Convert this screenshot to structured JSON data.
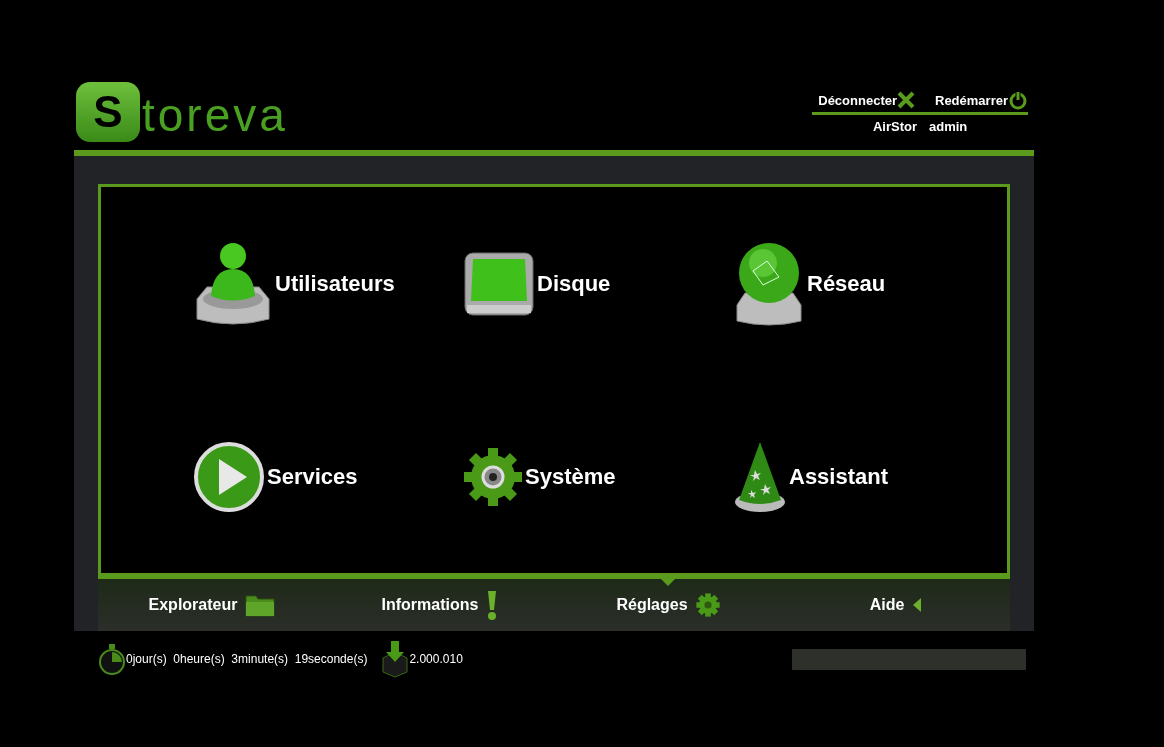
{
  "logo": {
    "letter": "S",
    "rest": "toreva"
  },
  "header_links": [
    {
      "label": "Déconnecter",
      "kind": "logout"
    },
    {
      "label": "Redémarrer",
      "kind": "power"
    }
  ],
  "device": {
    "name": "AirStor",
    "user": "admin"
  },
  "apps": [
    {
      "label": "Utilisateurs",
      "kind": "user"
    },
    {
      "label": "Disque",
      "kind": "disk"
    },
    {
      "label": "Réseau",
      "kind": "globe"
    },
    {
      "label": "Services",
      "kind": "play"
    },
    {
      "label": "Système",
      "kind": "gear"
    },
    {
      "label": "Assistant",
      "kind": "hat"
    }
  ],
  "tabs": [
    {
      "label": "Explorateur",
      "kind": "folder",
      "selected": false
    },
    {
      "label": "Informations",
      "kind": "exclaim",
      "selected": false
    },
    {
      "label": "Réglages",
      "kind": "gear",
      "selected": true
    },
    {
      "label": "Aide",
      "kind": "caret",
      "selected": false
    }
  ],
  "status_bar": {
    "uptime": "0jour(s)  0heure(s)  3minute(s)  19seconde(s)",
    "version": "2.000.010"
  }
}
